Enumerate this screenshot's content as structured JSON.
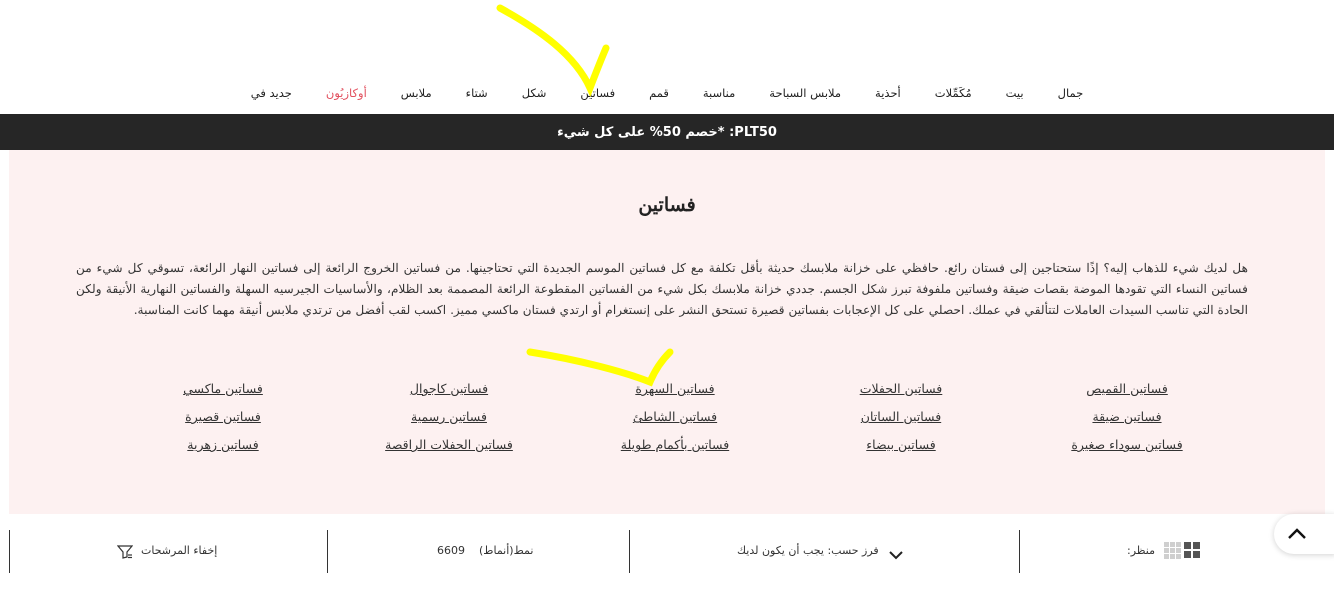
{
  "nav": {
    "items": [
      "جمال",
      "بيت",
      "مُكَمِّلات",
      "أحذية",
      "ملابس السباحة",
      "مناسبة",
      "قمم",
      "فساتين",
      "شكل",
      "شتاء",
      "ملابس",
      "أوكازيُون",
      "جديد في"
    ],
    "sale_color": "#e2515f"
  },
  "promo": {
    "text": "PLT50: *خصم 50% على كل شيء"
  },
  "page": {
    "title": "فساتين",
    "description": "هل لديك شيء للذهاب إليه؟ إذًا ستحتاجين إلى فستان رائع. حافظي على خزانة ملابسك حديثة بأقل تكلفة مع كل فساتين الموسم الجديدة التي تحتاجينها. من فساتين الخروج الرائعة إلى فساتين النهار الرائعة، تسوقي كل شيء من فساتين النساء التي تقودها الموضة بقصات ضيقة وفساتين ملفوفة تبرز شكل الجسم. جددي خزانة ملابسك بكل شيء من الفساتين المقطوعة الرائعة المصممة بعد الظلام، والأساسيات الجيرسيه السهلة والفساتين النهارية الأنيقة ولكن الحادة التي تناسب السيدات العاملات لتتألقي في عملك. احصلي على كل الإعجابات بفساتين قصيرة تستحق النشر على إنستغرام أو ارتدي فستان ماكسي مميز. اكسب لقب أفضل من ترتدي ملابس أنيقة مهما كانت المناسبة."
  },
  "categories": [
    "فساتين القميص",
    "فساتين ضيقة",
    "فساتين سوداء صغيرة",
    "فساتين الحفلات",
    "فساتين الساتان",
    "فساتين بيضاء",
    "فساتين السهرة",
    "فساتين الشاطئ",
    "فساتين بأكمام طويلة",
    "فساتين كاجوال",
    "فساتين رسمية",
    "فساتين الحفلات الراقصة",
    "فساتين ماكسي",
    "فساتين قصيرة",
    "فساتين زهرية"
  ],
  "filterbar": {
    "view_label": "منظر:",
    "sort_label": "فرز حسب: يجب أن يكون لديك",
    "count_label": "نمط(أنماط)",
    "count_value": "6609",
    "hide_filters_label": "إخفاء المرشحات"
  },
  "colors": {
    "promo_bg": "#262626",
    "panel_bg": "#fdf1f1",
    "annotation": "#ffff00"
  },
  "icons": [
    "grid-4-icon",
    "grid-9-icon",
    "chevron-down-icon",
    "filter-icon",
    "chevron-up-icon"
  ]
}
